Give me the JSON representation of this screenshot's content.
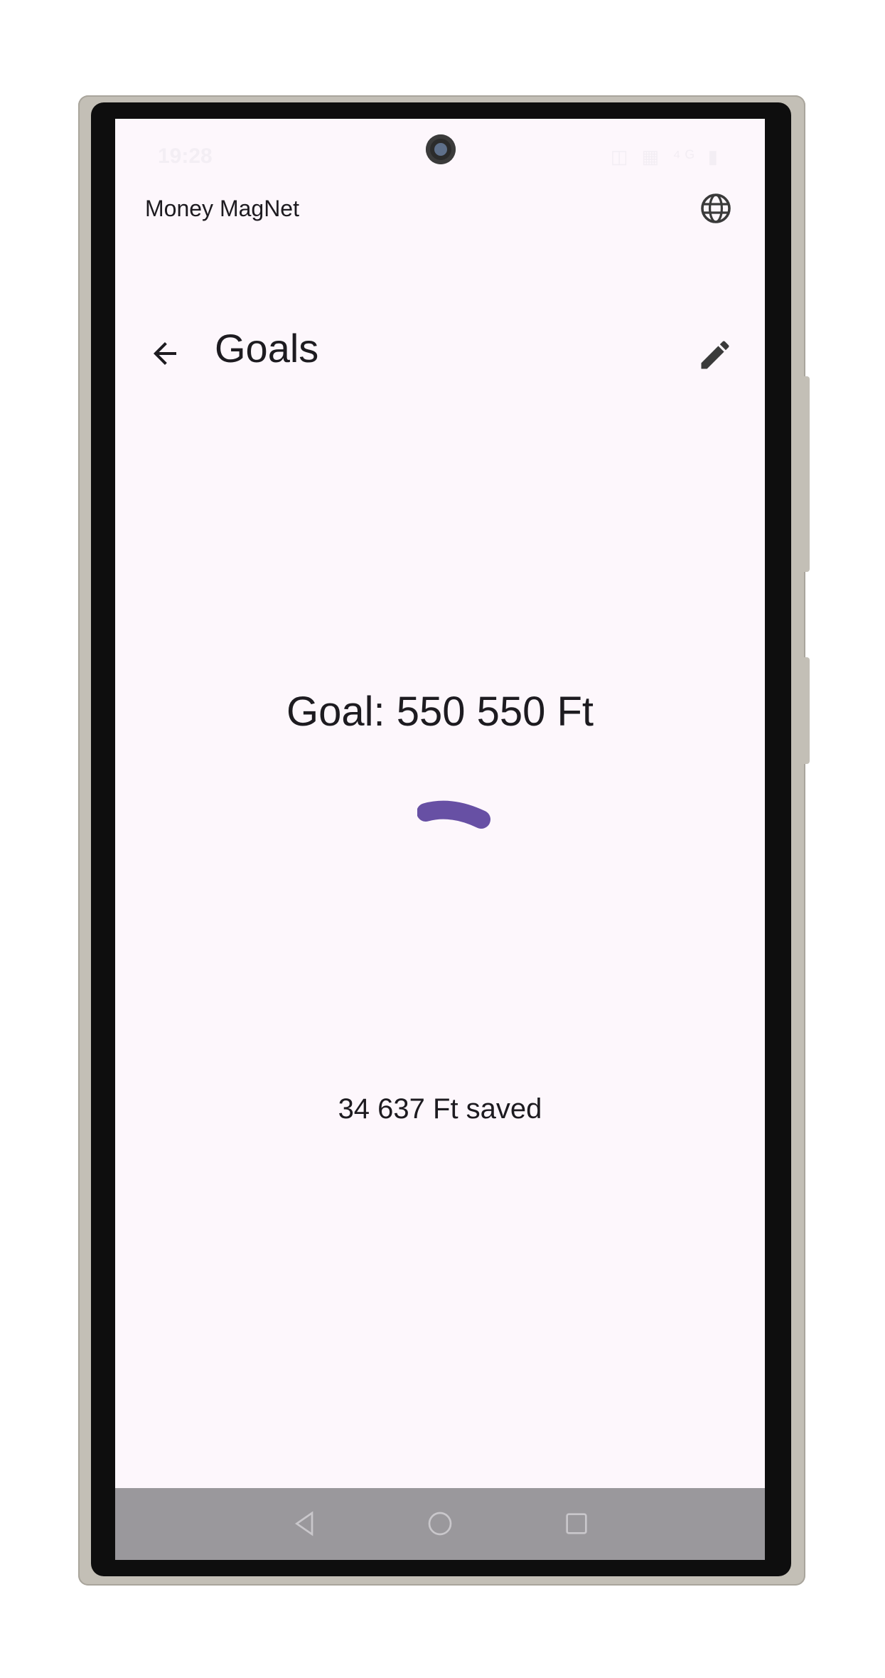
{
  "status_bar": {
    "time": "19:28",
    "icons": "◫ ▦ ⁴ᴳ ▮"
  },
  "app": {
    "title": "Money MagNet",
    "globe_icon": "globe-icon"
  },
  "toolbar": {
    "title": "Goals",
    "back_icon": "arrow-back-icon",
    "edit_icon": "edit-pencil-icon"
  },
  "goal": {
    "label": "Goal: 550 550 Ft",
    "saved": "34 637 Ft saved"
  },
  "colors": {
    "background": "#fdf7fc",
    "accent": "#6750a4",
    "text": "#1d1b20",
    "nav_bar": "#9a989c"
  },
  "nav": {
    "back_icon": "triangle-back-icon",
    "home_icon": "circle-home-icon",
    "recents_icon": "square-recents-icon"
  }
}
